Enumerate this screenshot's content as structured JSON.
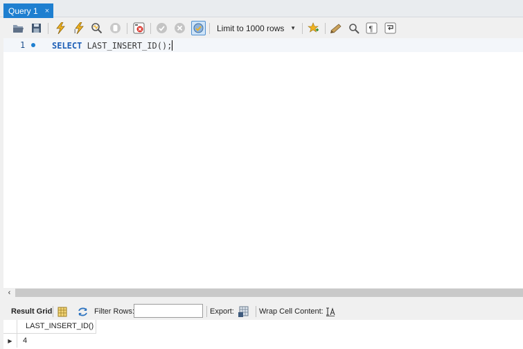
{
  "tab": {
    "title": "Query 1",
    "close_glyph": "×"
  },
  "toolbar": {
    "icons": [
      "open-folder-icon",
      "save-icon",
      "execute-icon",
      "execute-current-icon",
      "explain-icon",
      "stop-icon",
      "toggle-error-icon",
      "commit-icon",
      "rollback-icon",
      "autocommit-icon",
      "bookmark-icon",
      "beautify-icon",
      "find-icon",
      "invisible-chars-icon",
      "wrap-icon"
    ],
    "limit_label": "Limit to 1000 rows"
  },
  "editor": {
    "line_number": "1",
    "keyword": "SELECT",
    "rest": " LAST_INSERT_ID();"
  },
  "result": {
    "result_grid_label": "Result Grid",
    "filter_rows_label": "Filter Rows:",
    "filter_value": "",
    "export_label": "Export:",
    "wrap_label": "Wrap Cell Content:",
    "columns": [
      "LAST_INSERT_ID()"
    ],
    "rows": [
      [
        "4"
      ]
    ]
  },
  "colors": {
    "tab_accent": "#1e7fd0",
    "keyword": "#1d5fb6"
  }
}
